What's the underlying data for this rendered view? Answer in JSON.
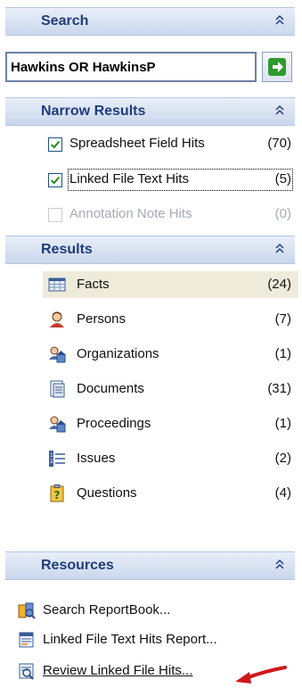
{
  "search": {
    "title": "Search",
    "query": "Hawkins OR HawkinsP"
  },
  "narrow": {
    "title": "Narrow Results",
    "items": [
      {
        "label": "Spreadsheet Field Hits",
        "count": "(70)",
        "checked": true,
        "enabled": true
      },
      {
        "label": "Linked File Text Hits",
        "count": "(5)",
        "checked": true,
        "enabled": true
      },
      {
        "label": "Annotation Note Hits",
        "count": "(0)",
        "checked": false,
        "enabled": false
      }
    ]
  },
  "results": {
    "title": "Results",
    "items": [
      {
        "label": "Facts",
        "count": "(24)",
        "icon": "table-icon"
      },
      {
        "label": "Persons",
        "count": "(7)",
        "icon": "person-icon"
      },
      {
        "label": "Organizations",
        "count": "(1)",
        "icon": "organization-icon"
      },
      {
        "label": "Documents",
        "count": "(31)",
        "icon": "document-icon"
      },
      {
        "label": "Proceedings",
        "count": "(1)",
        "icon": "proceedings-icon"
      },
      {
        "label": "Issues",
        "count": "(2)",
        "icon": "issues-list-icon"
      },
      {
        "label": "Questions",
        "count": "(4)",
        "icon": "question-icon"
      }
    ]
  },
  "resources": {
    "title": "Resources",
    "items": [
      {
        "label": "Search ReportBook...",
        "icon": "reportbook-icon"
      },
      {
        "label": "Linked File Text Hits Report...",
        "icon": "report-icon"
      },
      {
        "label": "Review Linked File Hits...",
        "icon": "review-icon"
      }
    ]
  },
  "colors": {
    "header_text": "#203d7a",
    "go_arrow": "#2e9a2e",
    "selected_row": "#efebdb",
    "annotation_arrow": "#d0181c"
  }
}
